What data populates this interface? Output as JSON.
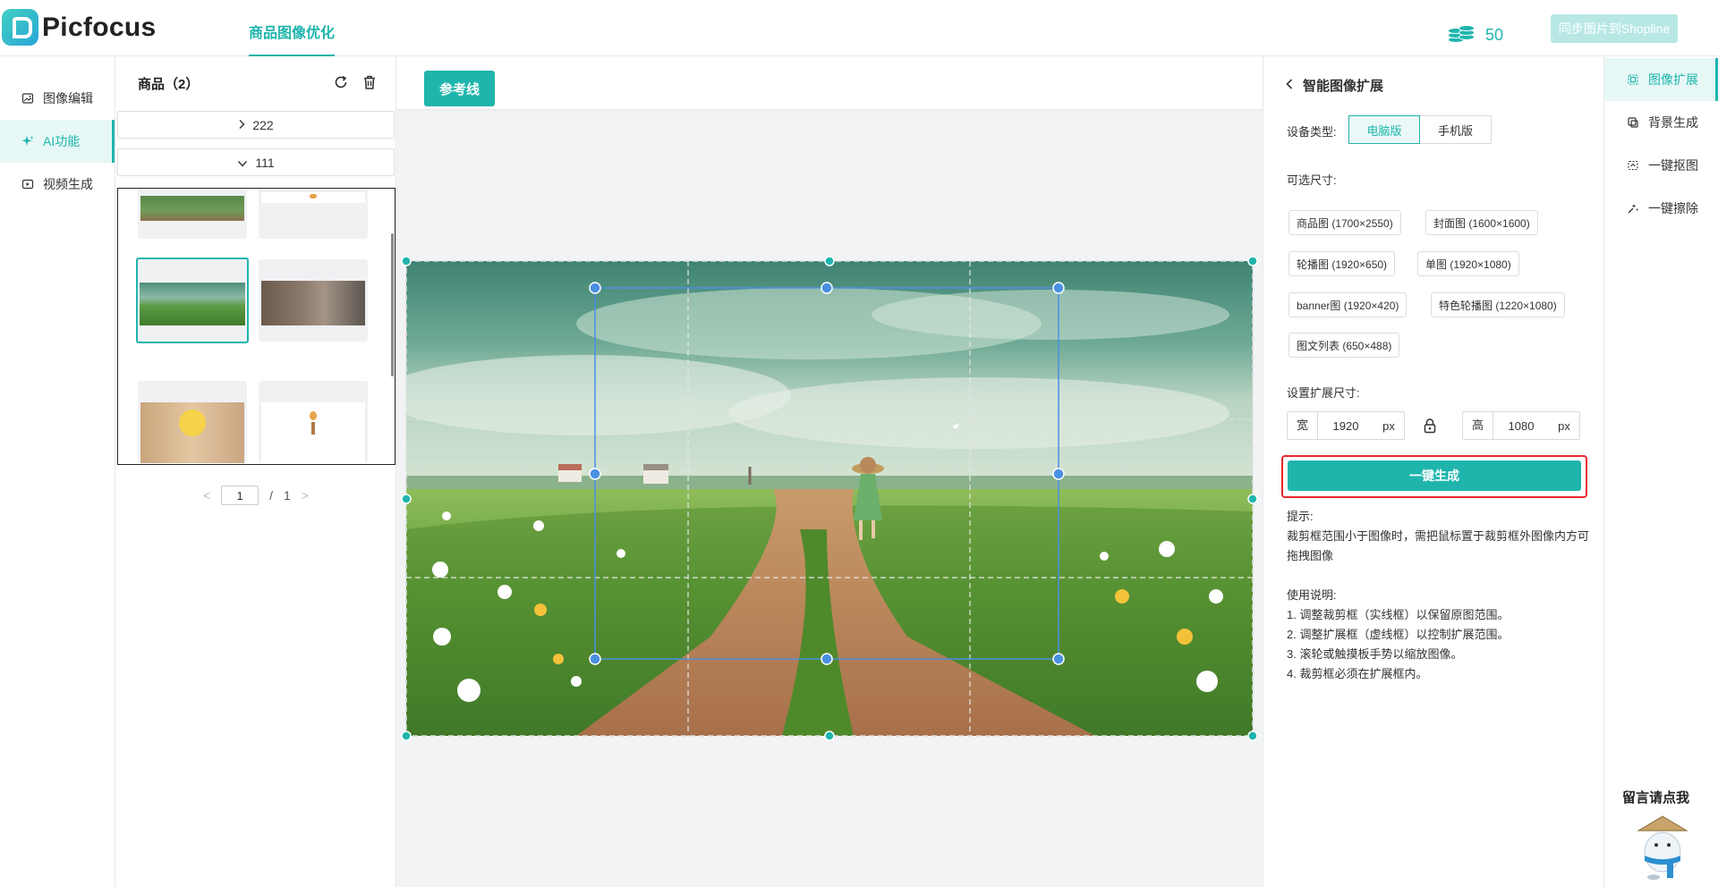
{
  "header": {
    "logo_text": "Picfocus",
    "active_tab": "商品图像优化",
    "credits": "50",
    "sync_button": "同步图片到Shopline"
  },
  "left_nav": {
    "items": [
      {
        "label": "图像编辑",
        "icon": "image-edit-icon",
        "active": false
      },
      {
        "label": "AI功能",
        "icon": "sparkle-icon",
        "active": true
      },
      {
        "label": "视频生成",
        "icon": "video-icon",
        "active": false
      }
    ]
  },
  "products": {
    "title": "商品（2）",
    "groups": [
      {
        "label": "222",
        "expanded": false
      },
      {
        "label": "111",
        "expanded": true
      }
    ],
    "pagination": {
      "current": "1",
      "separator": "/",
      "total": "1"
    }
  },
  "canvas": {
    "guide_button": "参考线"
  },
  "settings": {
    "title": "智能图像扩展",
    "device_label": "设备类型:",
    "device_options": [
      "电脑版",
      "手机版"
    ],
    "device_selected": "电脑版",
    "size_label": "可选尺寸:",
    "sizes": [
      "商品图 (1700×2550)",
      "封面图 (1600×1600)",
      "轮播图 (1920×650)",
      "单图 (1920×1080)",
      "banner图 (1920×420)",
      "特色轮播图 (1220×1080)",
      "图文列表 (650×488)"
    ],
    "expand_label": "设置扩展尺寸:",
    "width_prefix": "宽",
    "width_value": "1920",
    "height_prefix": "高",
    "height_value": "1080",
    "unit": "px",
    "generate_button": "一键生成",
    "tips_title": "提示:",
    "tips_text": "裁剪框范围小于图像时，需把鼠标置于裁剪框外图像内方可拖拽图像",
    "usage_title": "使用说明:",
    "usage_items": [
      "1. 调整裁剪框（实线框）以保留原图范围。",
      "2. 调整扩展框（虚线框）以控制扩展范围。",
      "3. 滚轮或触摸板手势以缩放图像。",
      "4. 裁剪框必须在扩展框内。"
    ]
  },
  "tools": {
    "items": [
      {
        "label": "图像扩展",
        "icon": "image-expand-icon",
        "active": true
      },
      {
        "label": "背景生成",
        "icon": "background-icon",
        "active": false
      },
      {
        "label": "一键抠图",
        "icon": "cutout-icon",
        "active": false
      },
      {
        "label": "一键擦除",
        "icon": "eraser-icon",
        "active": false
      }
    ],
    "feedback": "留言请点我"
  },
  "colors": {
    "accent": "#1fb5ad",
    "highlight_frame": "#e8272e",
    "crop_handle": "#4a90e2"
  }
}
